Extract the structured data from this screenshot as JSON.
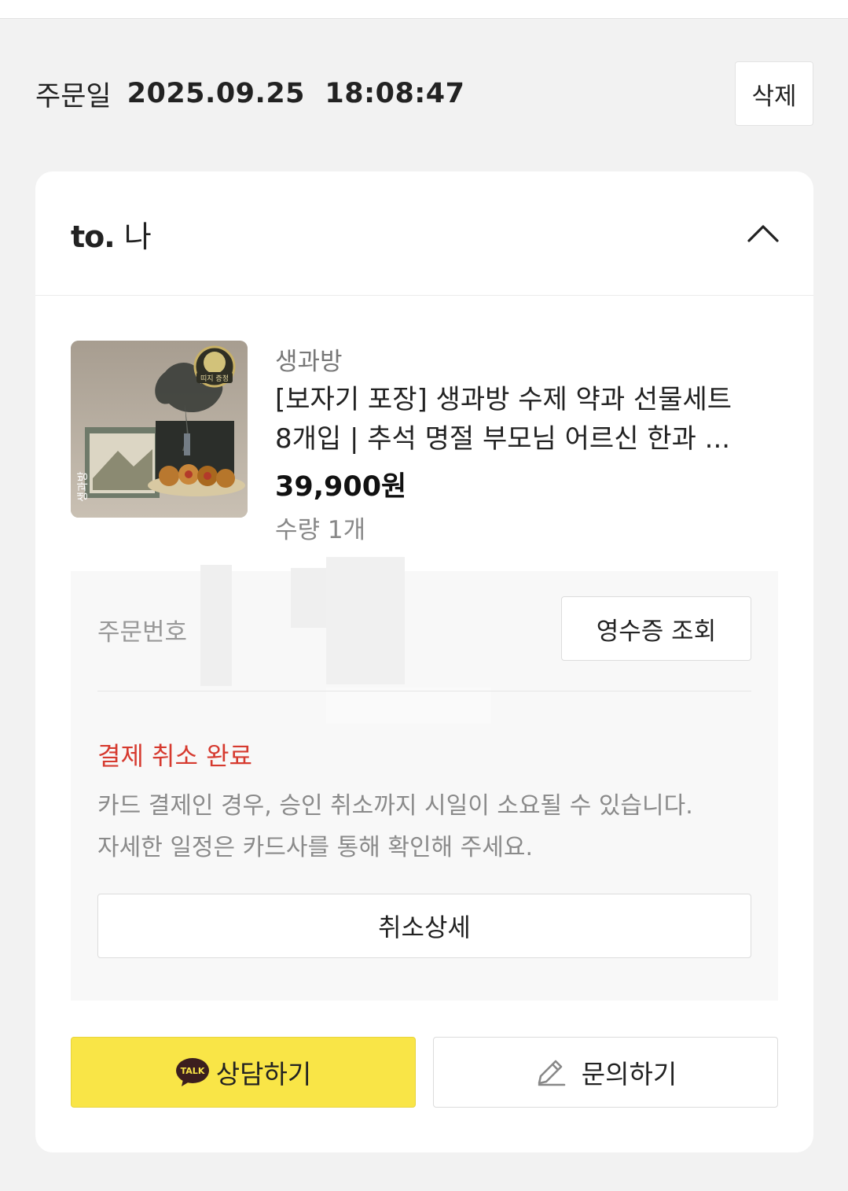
{
  "order": {
    "date_label": "주문일",
    "date_value": "2025.09.25  18:08:47",
    "delete_label": "삭제"
  },
  "recipient": {
    "prefix": "to.",
    "name": "나"
  },
  "product": {
    "seller": "생과방",
    "title_line1": "[보자기 포장] 생과방 수제 약과 선물세트",
    "title_line2": "8개입 | 추석 명절 부모님 어르신 한과 ...",
    "price": "39,900원",
    "quantity": "수량 1개",
    "thumb_badge": "띠지 증정",
    "thumb_brand": "생과방"
  },
  "info": {
    "order_no_label": "주문번호",
    "receipt_label": "영수증 조회",
    "cancel_status": "결제 취소 완료",
    "cancel_note_line1": "카드 결제인 경우, 승인 취소까지 시일이 소요될 수 있습니다.",
    "cancel_note_line2": "자세한 일정은 카드사를 통해 확인해 주세요.",
    "cancel_detail_label": "취소상세"
  },
  "actions": {
    "talk_icon_text": "TALK",
    "talk_label": "상담하기",
    "inquiry_label": "문의하기"
  },
  "colors": {
    "background": "#f2f2f2",
    "kakao_yellow": "#f9e547",
    "cancel_red": "#d63a2f"
  },
  "icons": {
    "collapse": "chevron-up-icon",
    "talk": "kakao-talk-icon",
    "inquiry": "pencil-icon"
  }
}
